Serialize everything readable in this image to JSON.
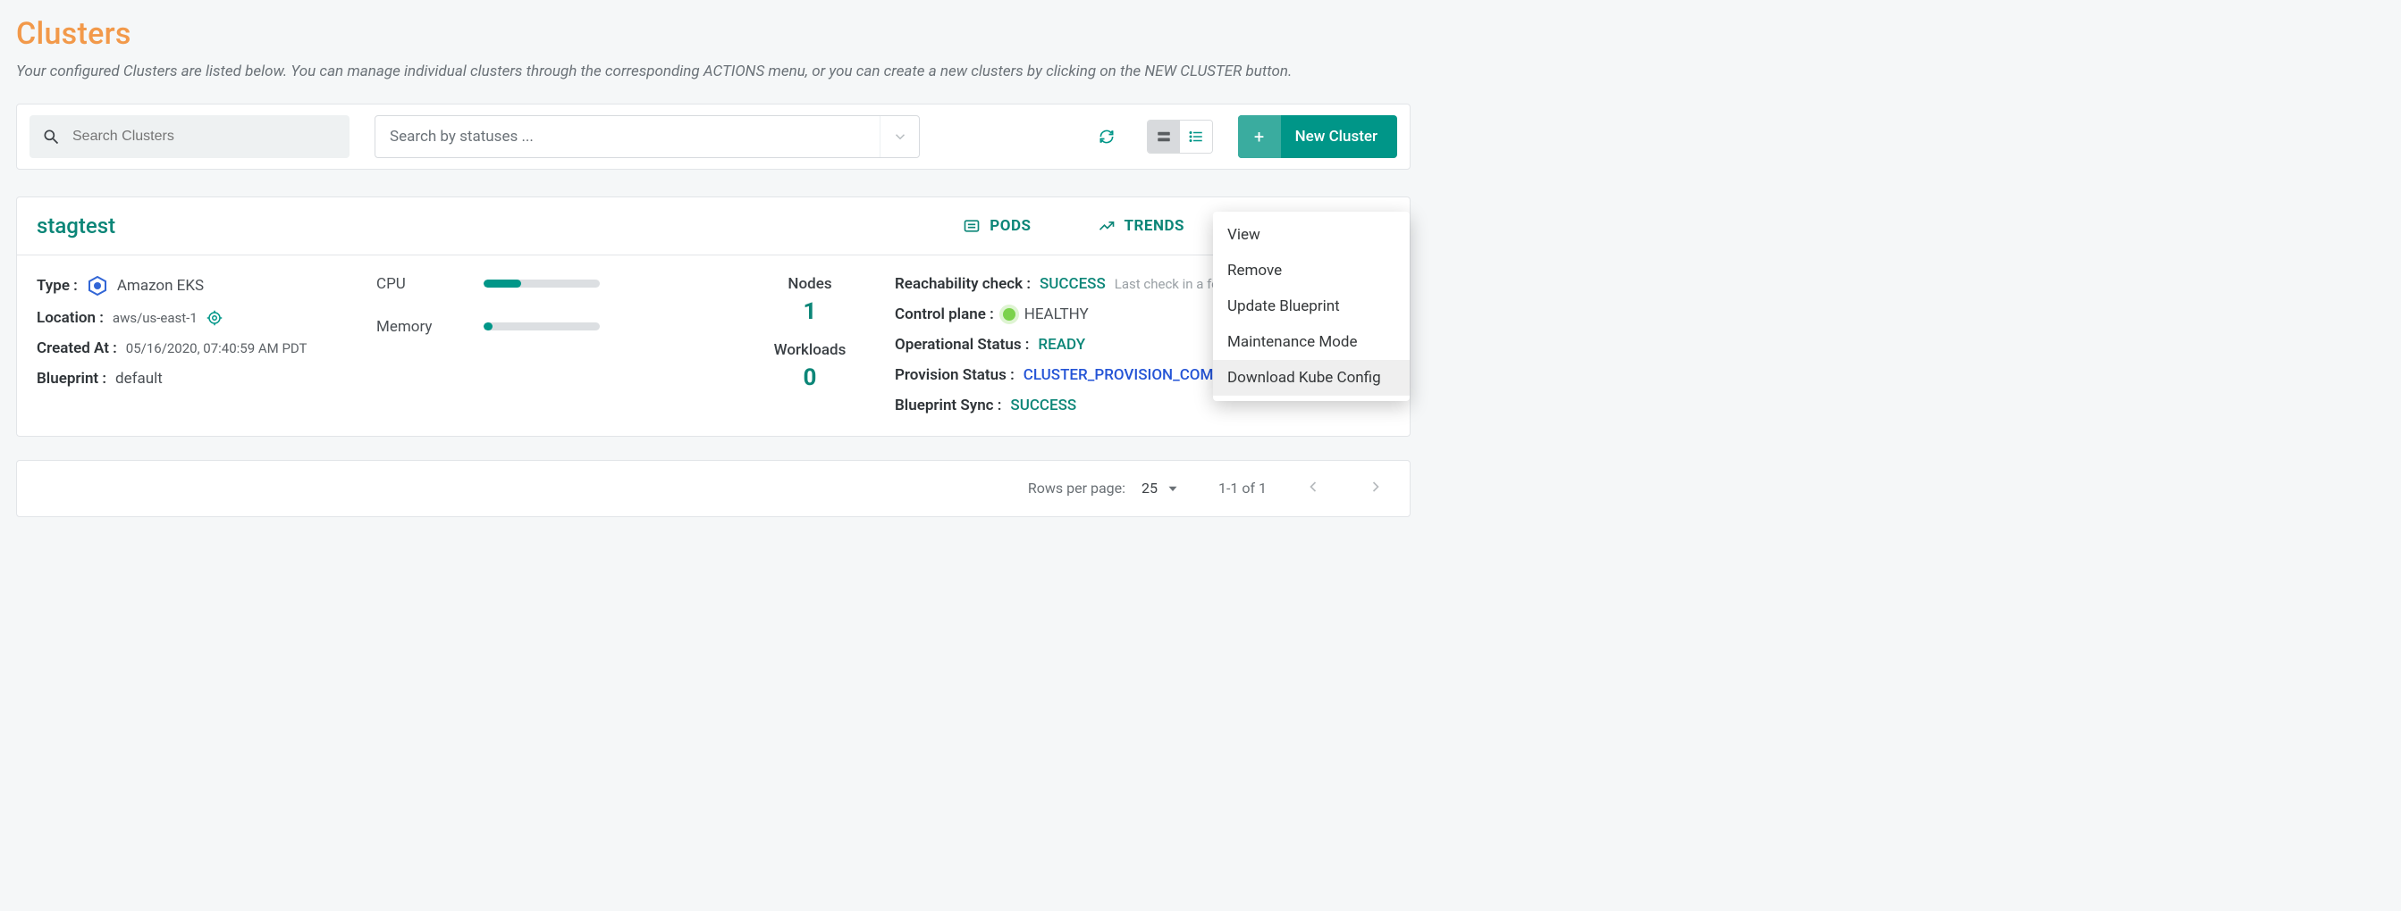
{
  "page": {
    "title": "Clusters",
    "subtitle": "Your configured Clusters are listed below. You can manage individual clusters through the corresponding ACTIONS menu, or you can create a new clusters by clicking on the NEW CLUSTER button."
  },
  "toolbar": {
    "search_placeholder": "Search Clusters",
    "status_placeholder": "Search by statuses ...",
    "new_cluster_label": "New Cluster"
  },
  "head_links": {
    "pods": "PODS",
    "trends": "TRENDS"
  },
  "cluster": {
    "name": "stagtest",
    "meta": {
      "type_label": "Type :",
      "type_value": "Amazon EKS",
      "location_label": "Location :",
      "location_value": "aws/us-east-1",
      "created_label": "Created At :",
      "created_value": "05/16/2020, 07:40:59 AM PDT",
      "blueprint_label": "Blueprint :",
      "blueprint_value": "default"
    },
    "resources": {
      "cpu_label": "CPU",
      "cpu_percent": 32,
      "mem_label": "Memory",
      "mem_percent": 8
    },
    "counts": {
      "nodes_label": "Nodes",
      "nodes_value": "1",
      "workloads_label": "Workloads",
      "workloads_value": "0"
    },
    "status": {
      "reach_label": "Reachability check :",
      "reach_value": "SUCCESS",
      "reach_note": "Last check in a fe",
      "control_label": "Control plane :",
      "control_value": "HEALTHY",
      "op_label": "Operational Status :",
      "op_value": "READY",
      "prov_label": "Provision Status :",
      "prov_value": "CLUSTER_PROVISION_COM",
      "bp_label": "Blueprint Sync :",
      "bp_value": "SUCCESS"
    }
  },
  "menu": {
    "view": "View",
    "remove": "Remove",
    "update": "Update Blueprint",
    "maint": "Maintenance Mode",
    "kube": "Download Kube Config"
  },
  "pager": {
    "rpp_label": "Rows per page:",
    "rpp_value": "25",
    "range": "1-1 of 1"
  }
}
